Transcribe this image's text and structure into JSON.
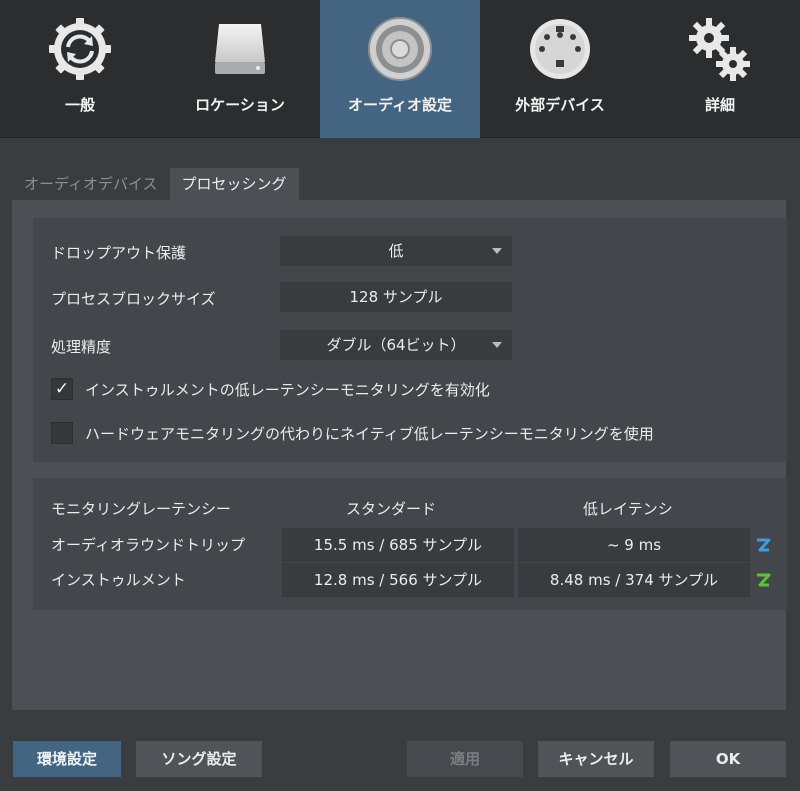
{
  "toolbar": {
    "items": [
      {
        "label": "一般",
        "icon": "general-sync-gear-icon",
        "active": false
      },
      {
        "label": "ロケーション",
        "icon": "drive-icon",
        "active": false
      },
      {
        "label": "オーディオ設定",
        "icon": "speaker-icon",
        "active": true
      },
      {
        "label": "外部デバイス",
        "icon": "midi-port-icon",
        "active": false
      },
      {
        "label": "詳細",
        "icon": "gears-icon",
        "active": false
      }
    ]
  },
  "tabs": [
    {
      "label": "オーディオデバイス",
      "active": false
    },
    {
      "label": "プロセッシング",
      "active": true
    }
  ],
  "processing": {
    "dropout_label": "ドロップアウト保護",
    "dropout_value": "低",
    "block_label": "プロセスブロックサイズ",
    "block_value": "128 サンプル",
    "precision_label": "処理精度",
    "precision_value": "ダブル（64ビット）",
    "instrument_lowlatency_label": "インストゥルメントの低レーテンシーモニタリングを有効化",
    "instrument_lowlatency_checked": true,
    "native_lowlatency_label": "ハードウェアモニタリングの代わりにネイティブ低レーテンシーモニタリングを使用",
    "native_lowlatency_checked": false,
    "check_mark": "✓"
  },
  "latency": {
    "header": "モニタリングレーテンシー",
    "col_standard": "スタンダード",
    "col_low": "低レイテンシ",
    "rows": [
      {
        "label": "オーディオラウンドトリップ",
        "standard": "15.5 ms / 685 サンプル",
        "low": "~ 9 ms",
        "icon_color": "#3e9be0"
      },
      {
        "label": "インストゥルメント",
        "standard": "12.8 ms / 566 サンプル",
        "low": "8.48 ms / 374 サンプル",
        "icon_color": "#5cc23c"
      }
    ]
  },
  "buttons": {
    "preferences": "環境設定",
    "song_settings": "ソング設定",
    "apply": "適用",
    "cancel": "キャンセル",
    "ok": "OK"
  }
}
